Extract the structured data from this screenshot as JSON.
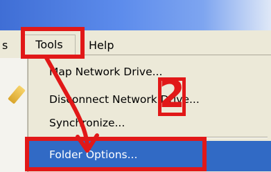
{
  "menubar": {
    "partial_label": "s",
    "tools_label": "Tools",
    "help_label": "Help"
  },
  "dropdown": {
    "items": [
      {
        "label": "Map Network Drive..."
      },
      {
        "label": "Disconnect Network Drive..."
      },
      {
        "label": "Synchronize..."
      },
      {
        "label": "Folder Options..."
      }
    ],
    "highlighted_index": 3
  },
  "annotations": {
    "step_number": "2",
    "color": "#e11818"
  },
  "colors": {
    "menu_bg": "#ece9d8",
    "highlight_bg": "#316ac5",
    "title_bar": "#3f6ed5"
  }
}
